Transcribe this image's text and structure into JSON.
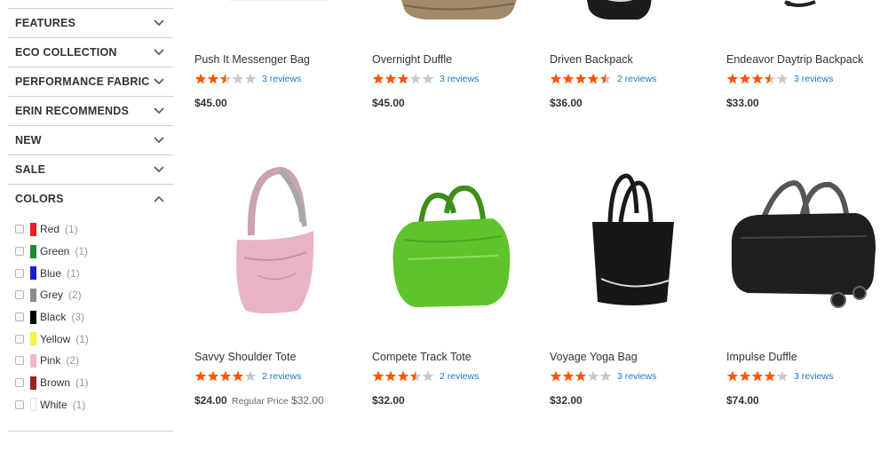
{
  "filters": [
    {
      "label": "FEATURES",
      "expanded": false
    },
    {
      "label": "ECO COLLECTION",
      "expanded": false
    },
    {
      "label": "PERFORMANCE FABRIC",
      "expanded": false
    },
    {
      "label": "ERIN RECOMMENDS",
      "expanded": false
    },
    {
      "label": "NEW",
      "expanded": false
    },
    {
      "label": "SALE",
      "expanded": false
    },
    {
      "label": "COLORS",
      "expanded": true
    }
  ],
  "colors": [
    {
      "name": "Red",
      "count": "(1)",
      "hex": "#ee1c1c"
    },
    {
      "name": "Green",
      "count": "(1)",
      "hex": "#1e8b2f"
    },
    {
      "name": "Blue",
      "count": "(1)",
      "hex": "#1a1ae0"
    },
    {
      "name": "Grey",
      "count": "(2)",
      "hex": "#8c8c8c"
    },
    {
      "name": "Black",
      "count": "(3)",
      "hex": "#000000"
    },
    {
      "name": "Yellow",
      "count": "(1)",
      "hex": "#f5f53a"
    },
    {
      "name": "Pink",
      "count": "(2)",
      "hex": "#f5b8c8"
    },
    {
      "name": "Brown",
      "count": "(1)",
      "hex": "#9b2020"
    },
    {
      "name": "White",
      "count": "(1)",
      "hex": "#ffffff"
    }
  ],
  "star_color": "#ff5501",
  "star_empty_color": "#c8c8c8",
  "products": [
    {
      "name": "Push It Messenger Bag",
      "rating": 2.5,
      "reviews": "3 reviews",
      "price": "$45.00",
      "image": "messenger-bag"
    },
    {
      "name": "Overnight Duffle",
      "rating": 3,
      "reviews": "3 reviews",
      "price": "$45.00",
      "image": "duffle-tan"
    },
    {
      "name": "Driven Backpack",
      "rating": 4.5,
      "reviews": "2 reviews",
      "price": "$36.00",
      "image": "backpack-black"
    },
    {
      "name": "Endeavor Daytrip Backpack",
      "rating": 3.5,
      "reviews": "3 reviews",
      "price": "$33.00",
      "image": "backpack-strap"
    },
    {
      "name": "Savvy Shoulder Tote",
      "rating": 4,
      "reviews": "2 reviews",
      "price": "$24.00",
      "regular_label": "Regular Price",
      "regular_price": "$32.00",
      "image": "pink-tote"
    },
    {
      "name": "Compete Track Tote",
      "rating": 3.5,
      "reviews": "2 reviews",
      "price": "$32.00",
      "image": "green-tote"
    },
    {
      "name": "Voyage Yoga Bag",
      "rating": 3,
      "reviews": "3 reviews",
      "price": "$32.00",
      "image": "black-tote"
    },
    {
      "name": "Impulse Duffle",
      "rating": 4,
      "reviews": "3 reviews",
      "price": "$74.00",
      "image": "black-duffle"
    }
  ]
}
